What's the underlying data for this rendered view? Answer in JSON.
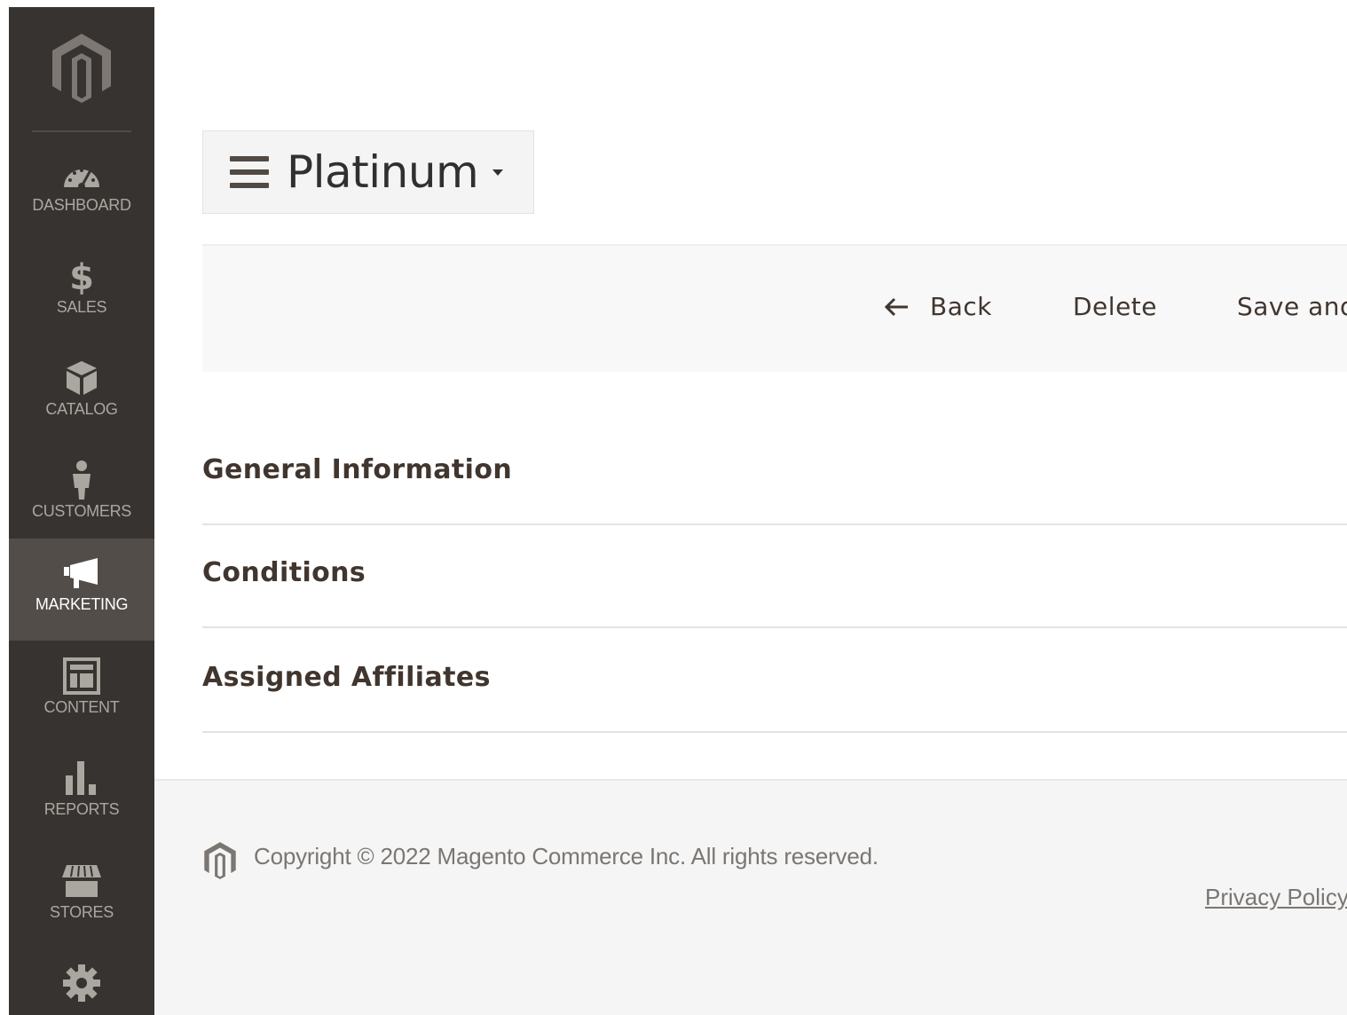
{
  "sidebar": {
    "items": [
      {
        "label": "DASHBOARD",
        "icon": "dashboard-gauge-icon"
      },
      {
        "label": "SALES",
        "icon": "dollar-icon"
      },
      {
        "label": "CATALOG",
        "icon": "box-icon"
      },
      {
        "label": "CUSTOMERS",
        "icon": "person-icon"
      },
      {
        "label": "MARKETING",
        "icon": "megaphone-icon",
        "active": true
      },
      {
        "label": "CONTENT",
        "icon": "layout-icon"
      },
      {
        "label": "REPORTS",
        "icon": "bar-chart-icon"
      },
      {
        "label": "STORES",
        "icon": "storefront-icon"
      },
      {
        "label": "",
        "icon": "gear-icon"
      }
    ]
  },
  "header": {
    "title": "Platinum"
  },
  "actions": {
    "back_label": "Back",
    "delete_label": "Delete",
    "save_label": "Save and"
  },
  "sections": [
    {
      "title": "General Information"
    },
    {
      "title": "Conditions"
    },
    {
      "title": "Assigned Affiliates"
    }
  ],
  "footer": {
    "copyright": "Copyright © 2022 Magento Commerce Inc. All rights reserved.",
    "privacy_label": "Privacy Policy"
  },
  "colors": {
    "sidebar_bg": "#373330",
    "sidebar_active_bg": "#524d49",
    "text_dark": "#41362f"
  }
}
